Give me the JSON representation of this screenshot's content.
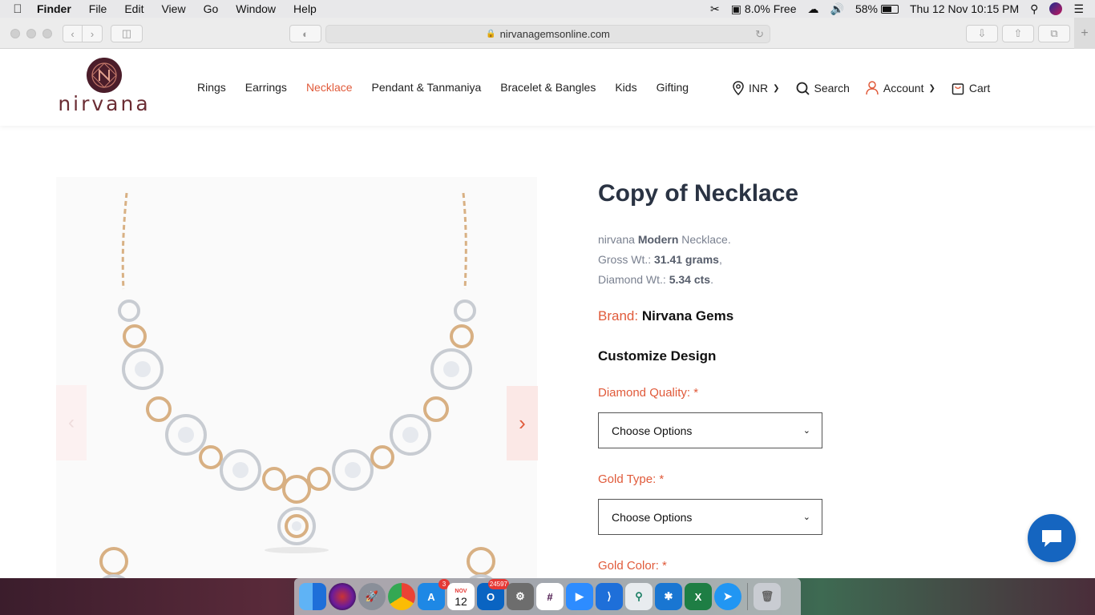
{
  "menubar": {
    "app_name": "Finder",
    "items": [
      "File",
      "Edit",
      "View",
      "Go",
      "Window",
      "Help"
    ],
    "memory_free": "8.0% Free",
    "battery": "58%",
    "datetime": "Thu 12 Nov  10:15 PM"
  },
  "browser": {
    "url": "nirvanagemsonline.com"
  },
  "site": {
    "logo_text": "nirvana",
    "nav": [
      "Rings",
      "Earrings",
      "Necklace",
      "Pendant & Tanmaniya",
      "Bracelet & Bangles",
      "Kids",
      "Gifting"
    ],
    "active_nav": "Necklace",
    "currency": "INR",
    "search_label": "Search",
    "account_label": "Account",
    "cart_label": "Cart"
  },
  "product": {
    "title": "Copy of Necklace",
    "desc_prefix": "nirvana ",
    "desc_style": "Modern",
    "desc_suffix": " Necklace.",
    "gross_label": "Gross Wt.: ",
    "gross_value": "31.41 grams",
    "diamond_label": "Diamond Wt.: ",
    "diamond_value": "5.34 cts",
    "brand_label": "Brand: ",
    "brand_value": "Nirvana Gems",
    "customize_heading": "Customize Design",
    "fields": [
      {
        "label": "Diamond Quality: *",
        "value": "Choose Options"
      },
      {
        "label": "Gold Type: *",
        "value": "Choose Options"
      },
      {
        "label": "Gold Color: *"
      }
    ]
  },
  "dock": {
    "app_store_badge": "3",
    "calendar_month": "NOV",
    "calendar_day": "12",
    "outlook_badge": "24597"
  },
  "colors": {
    "accent": "#e05a3a",
    "chat": "#1565c0",
    "logo": "#6b2d34"
  }
}
